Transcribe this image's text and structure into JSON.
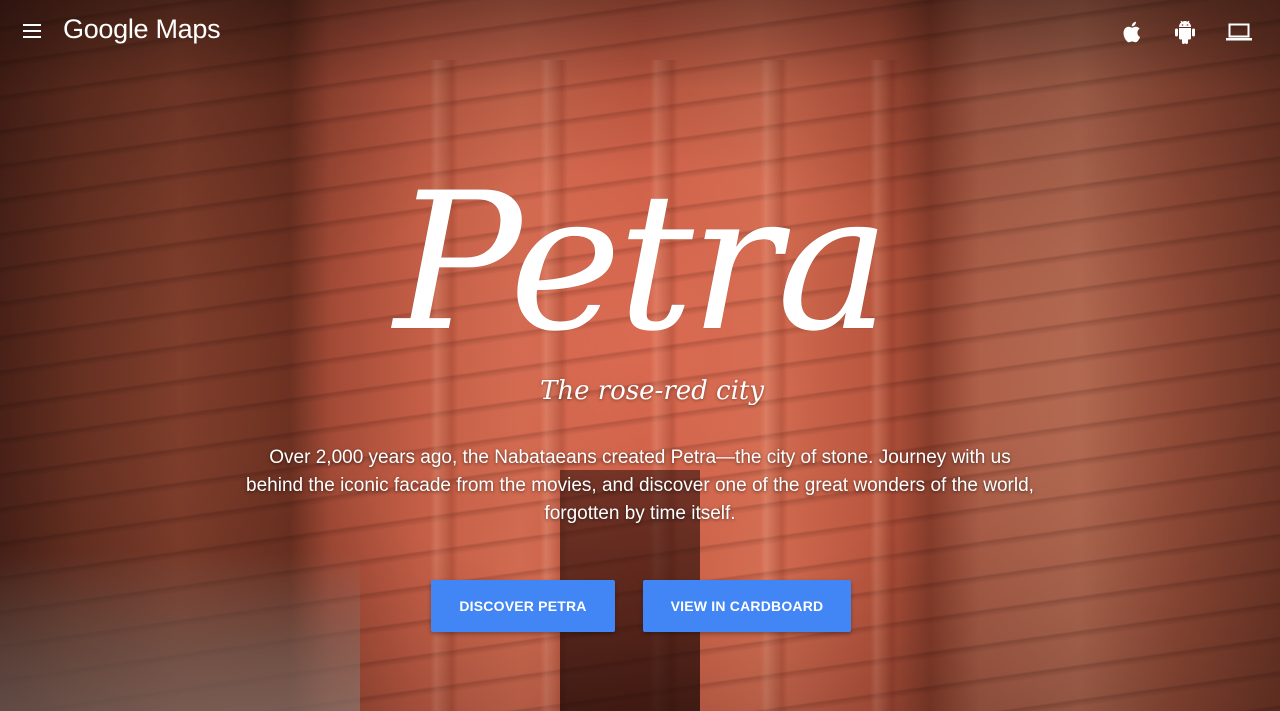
{
  "header": {
    "logo_text": "Google Maps",
    "icons": [
      "menu-icon",
      "apple-icon",
      "android-icon",
      "laptop-icon"
    ]
  },
  "hero": {
    "title": "Petra",
    "subtitle": "The rose-red city",
    "description": "Over 2,000 years ago, the Nabataeans created Petra—the city of stone. Journey with us behind the iconic facade from the movies, and discover one of the great wonders of the world, forgotten by time itself."
  },
  "actions": {
    "discover_label": "DISCOVER PETRA",
    "cardboard_label": "VIEW IN CARDBOARD"
  },
  "colors": {
    "button": "#4285f4",
    "text": "#ffffff"
  }
}
